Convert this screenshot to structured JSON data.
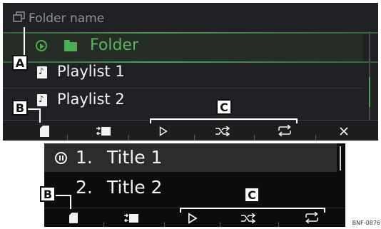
{
  "top_screen": {
    "header_title": "Folder name",
    "folder_label": "Folder",
    "playlists": [
      "Playlist 1",
      "Playlist 2"
    ],
    "toolbar_icons": [
      "sd-card-icon",
      "source-switch-icon",
      "play-icon",
      "shuffle-icon",
      "repeat-icon",
      "close-icon"
    ],
    "accent_color": "#4caf50"
  },
  "bottom_screen": {
    "tracks": [
      {
        "number": "1.",
        "title": "Title 1",
        "state": "paused"
      },
      {
        "number": "2.",
        "title": "Title 2",
        "state": ""
      }
    ],
    "toolbar_icons": [
      "sd-card-icon",
      "source-switch-icon",
      "play-icon",
      "shuffle-icon",
      "repeat-icon"
    ]
  },
  "callouts": {
    "a": "A",
    "b": "B",
    "c": "C"
  },
  "figure_ref": "BNF-0876"
}
